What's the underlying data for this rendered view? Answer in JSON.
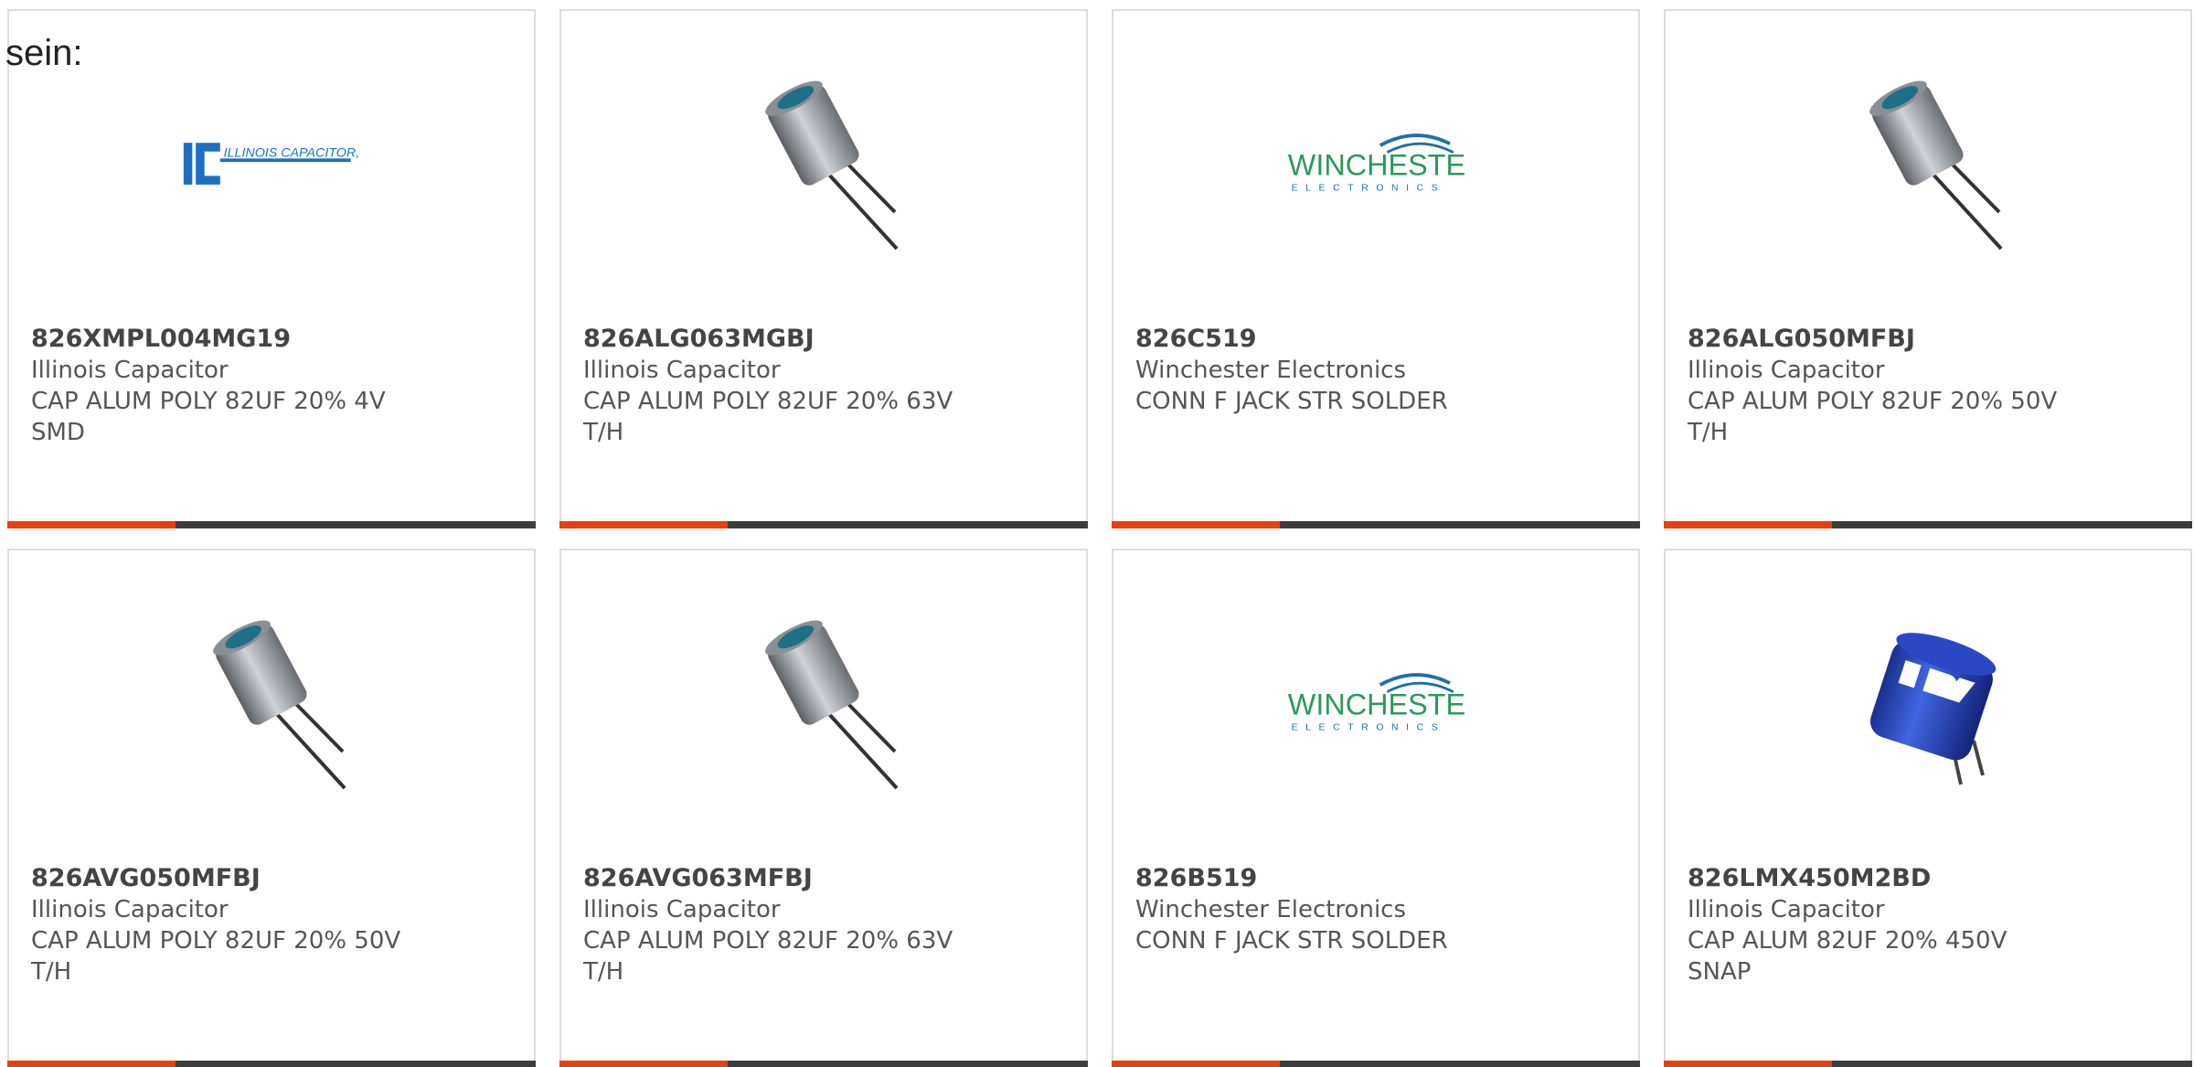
{
  "intro_text": "sein:",
  "products": [
    {
      "part_number": "826XMPL004MG19",
      "manufacturer": "Illinois Capacitor",
      "description": "CAP ALUM POLY 82UF 20% 4V SMD",
      "image": "illinois-capacitor-logo"
    },
    {
      "part_number": "826ALG063MGBJ",
      "manufacturer": "Illinois Capacitor",
      "description": "CAP ALUM POLY 82UF 20% 63V T/H",
      "image": "radial-capacitor-photo"
    },
    {
      "part_number": "826C519",
      "manufacturer": "Winchester Electronics",
      "description": "CONN F JACK STR SOLDER",
      "image": "winchester-electronics-logo"
    },
    {
      "part_number": "826ALG050MFBJ",
      "manufacturer": "Illinois Capacitor",
      "description": "CAP ALUM POLY 82UF 20% 50V T/H",
      "image": "radial-capacitor-photo"
    },
    {
      "part_number": "826AVG050MFBJ",
      "manufacturer": "Illinois Capacitor",
      "description": "CAP ALUM POLY 82UF 20% 50V T/H",
      "image": "radial-capacitor-photo"
    },
    {
      "part_number": "826AVG063MFBJ",
      "manufacturer": "Illinois Capacitor",
      "description": "CAP ALUM POLY 82UF 20% 63V T/H",
      "image": "radial-capacitor-photo"
    },
    {
      "part_number": "826B519",
      "manufacturer": "Winchester Electronics",
      "description": "CONN F JACK STR SOLDER",
      "image": "winchester-electronics-logo"
    },
    {
      "part_number": "826LMX450M2BD",
      "manufacturer": "Illinois Capacitor",
      "description": "CAP ALUM 82UF 20% 450V SNAP",
      "image": "snap-in-capacitor-photo"
    }
  ],
  "logos": {
    "illinois": "ILLINOIS CAPACITOR, INC.",
    "winchester_main": "WINCHESTER",
    "winchester_sub": "ELECTRONICS"
  },
  "colors": {
    "accent_red": "#e8400c",
    "accent_dark": "#3d3d3d",
    "illinois_blue": "#1e6fc4",
    "winchester_green": "#2a9a5a",
    "winchester_blue": "#1f6fa8"
  }
}
